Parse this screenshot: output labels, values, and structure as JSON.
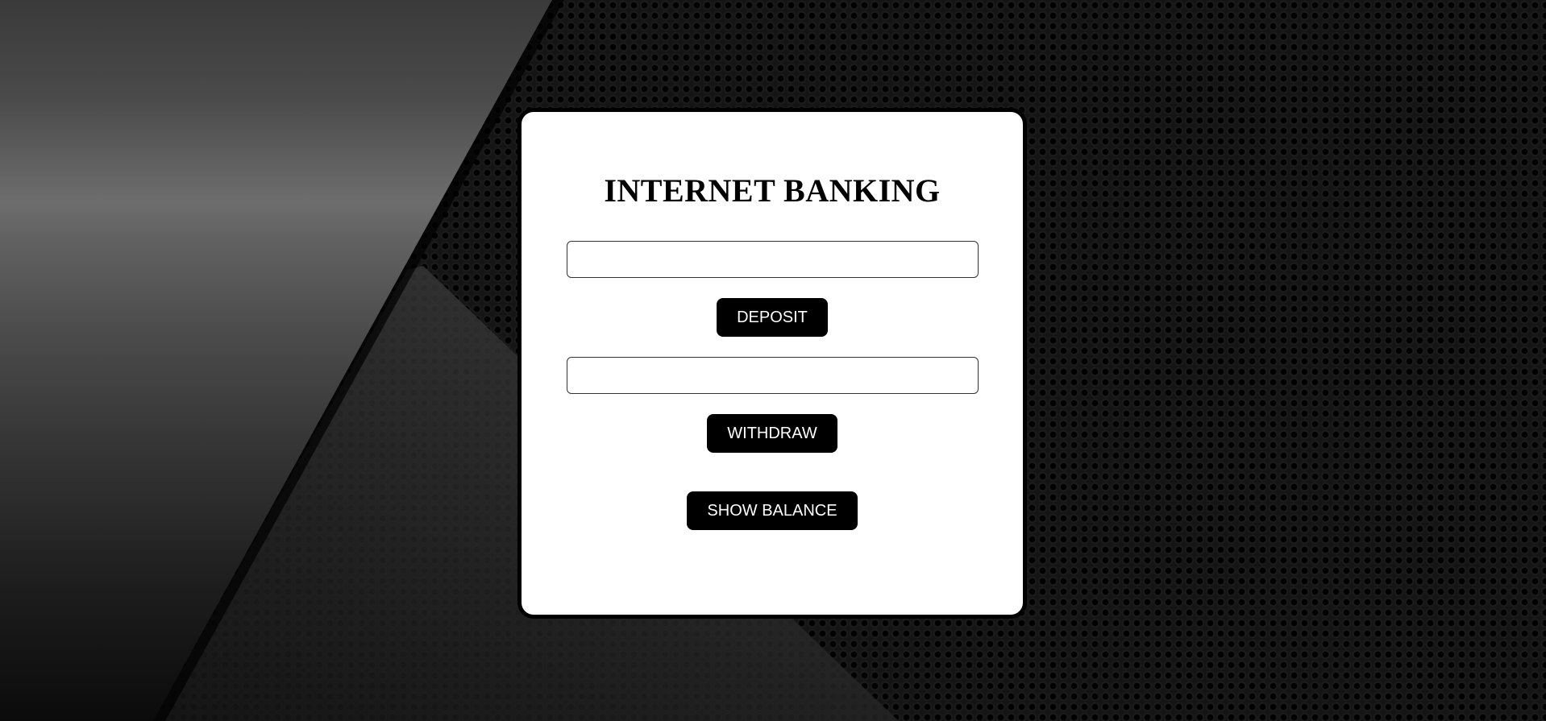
{
  "app": {
    "title": "INTERNET BANKING"
  },
  "deposit": {
    "input_value": "",
    "input_placeholder": "",
    "button_label": "DEPOSIT"
  },
  "withdraw": {
    "input_value": "",
    "input_placeholder": "",
    "button_label": "WITHDRAW"
  },
  "balance": {
    "button_label": "SHOW BALANCE"
  },
  "colors": {
    "card_background": "#ffffff",
    "button_background": "#000000",
    "button_text": "#ffffff",
    "page_background": "#0d0d0d"
  }
}
